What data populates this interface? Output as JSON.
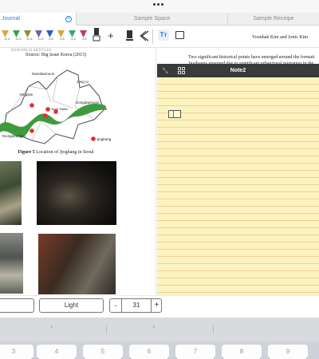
{
  "tabs": [
    {
      "label": "Journal",
      "active": true
    },
    {
      "label": "Sample Space",
      "active": false
    },
    {
      "label": "Sample Receipe",
      "active": false
    }
  ],
  "toolbar": {
    "pens": [
      {
        "color": "#e2a23a",
        "size": "11.8"
      },
      {
        "color": "#3c9d5a",
        "size": "11.8"
      },
      {
        "color": "#8a8f3a",
        "size": "11.8"
      },
      {
        "color": "#6a62b8",
        "size": "11.8"
      },
      {
        "color": "#2f5fb5",
        "size": "4.8"
      },
      {
        "color": "#e0a52e",
        "size": "4.8"
      },
      {
        "color": "#3aa873",
        "size": "4.8"
      },
      {
        "color": "#c13a6a",
        "size": "4.8"
      }
    ],
    "icons": [
      "pen-tool-icon",
      "plus-icon",
      "eraser-icon",
      "lasso-icon",
      "text-tool-icon",
      "image-icon"
    ],
    "text_tool_label": "Tт"
  },
  "left_doc": {
    "ghost_text": "RESEARCH ARTICLES",
    "source": "Source: Big Issue Korea (2013)",
    "map_labels": {
      "namdaemoon": "Namdaemoon",
      "jongro": "Jong ro",
      "yongsan": "Yongsan",
      "dongdaemoon": "Dongdaemoon",
      "seoul_station": "Seoul Station",
      "yeongdeungpo": "Yeongdeungpo",
      "jjogbang": "Jjogbang"
    },
    "figure_label": "Figure 5",
    "figure_caption": " Location of Jjogbang in Seoul"
  },
  "right_doc": {
    "authors": "Yoonhak Kim and Jonic Kim",
    "para_line1": "Two significant historical points have emerged around the formati",
    "para_line2": "Jjogbangs emerged due to significant urban/rural migration in the"
  },
  "note": {
    "title": "Note2"
  },
  "controls": {
    "left_button": "",
    "light_label": "Light",
    "minus": "-",
    "value": "31",
    "plus": "+"
  },
  "keyboard": {
    "suggest_mark": "I",
    "keys": [
      "3",
      "4",
      "5",
      "6",
      "7",
      "8",
      "9"
    ]
  }
}
